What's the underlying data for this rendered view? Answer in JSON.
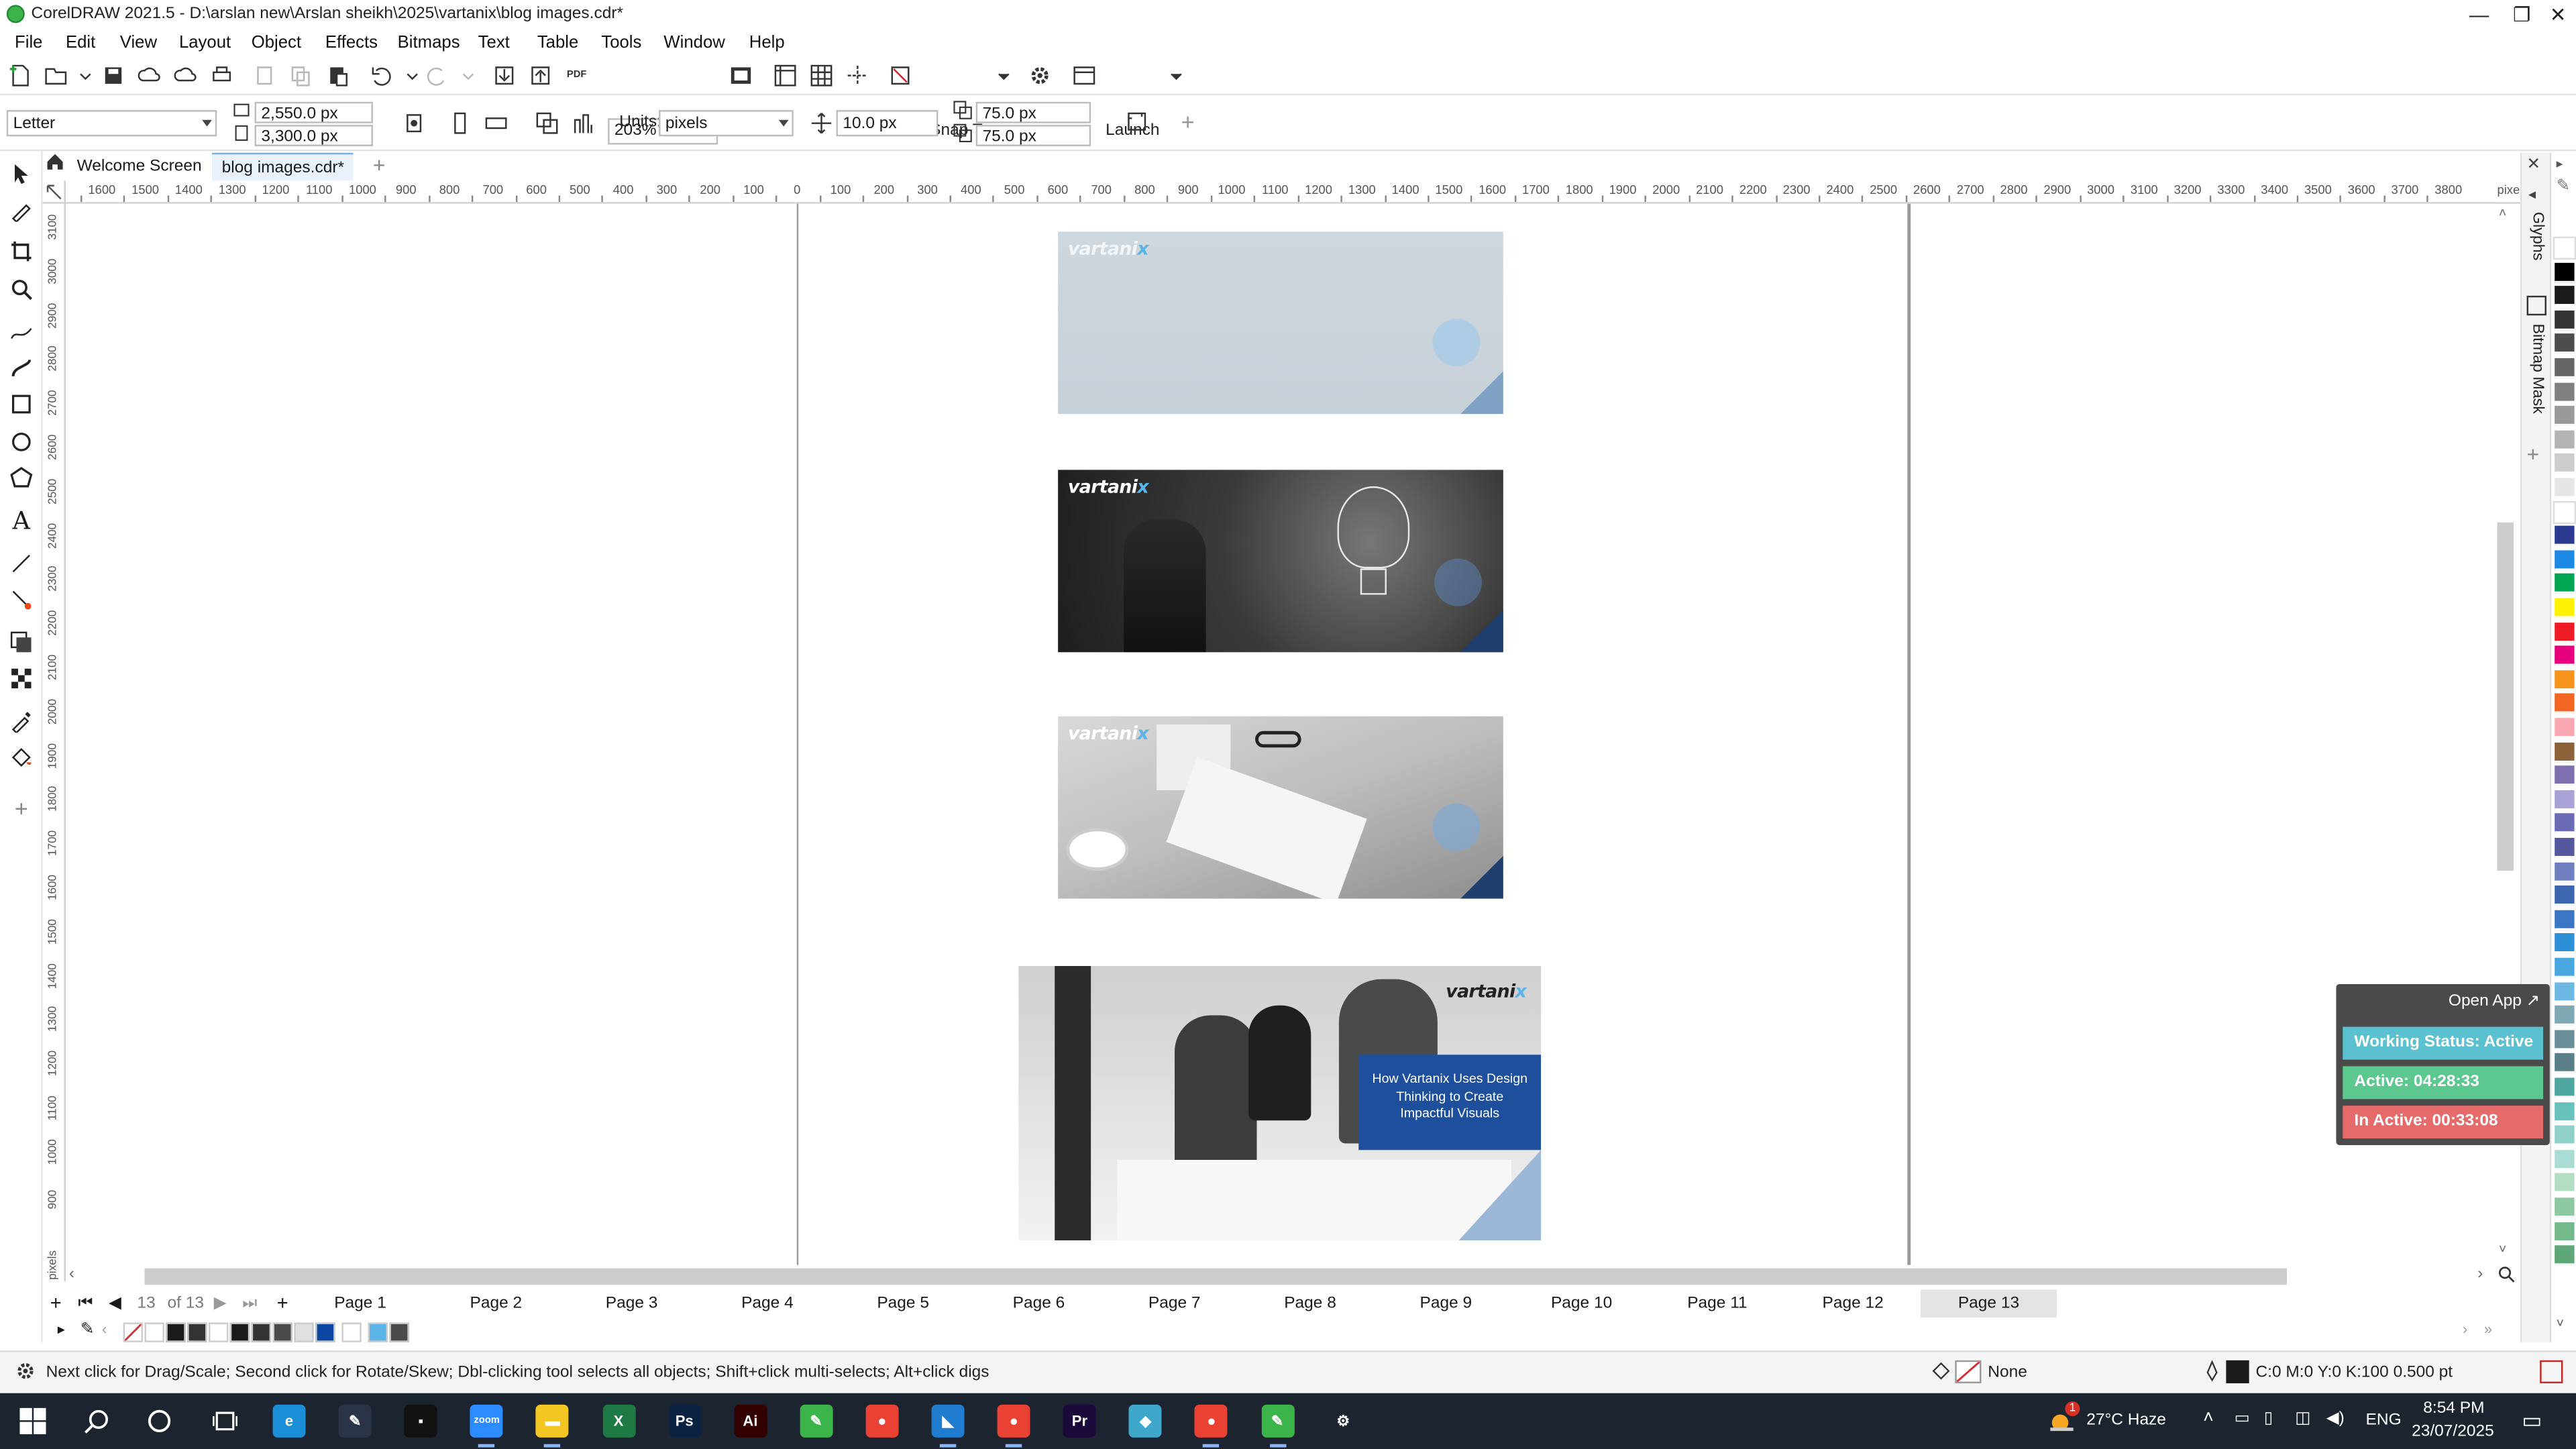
{
  "window": {
    "title": "CorelDRAW 2021.5 - D:\\arslan new\\Arslan sheikh\\2025\\vartanix\\blog images.cdr*",
    "controls": {
      "minimize": "—",
      "restore": "❐",
      "close": "✕"
    }
  },
  "menu": [
    "File",
    "Edit",
    "View",
    "Layout",
    "Object",
    "Effects",
    "Bitmaps",
    "Text",
    "Table",
    "Tools",
    "Window",
    "Help"
  ],
  "toolbar": {
    "zoom": "203%",
    "snap_to": "Snap To",
    "launch": "Launch",
    "pdf_label": "PDF"
  },
  "property_bar": {
    "page_size": "Letter",
    "width": "2,550.0 px",
    "height": "3,300.0 px",
    "units_label": "Units:",
    "units_value": "pixels",
    "nudge": "10.0 px",
    "dup_x": "75.0 px",
    "dup_y": "75.0 px"
  },
  "doc_tabs": {
    "welcome": "Welcome Screen",
    "active": "blog images.cdr*",
    "add": "+"
  },
  "ruler": {
    "h_ticks": [
      "1600",
      "1500",
      "1400",
      "1300",
      "1200",
      "1100",
      "1000",
      "900",
      "800",
      "700",
      "600",
      "500",
      "400",
      "300",
      "200",
      "100",
      "0",
      "100",
      "200",
      "300",
      "400",
      "500",
      "600",
      "700",
      "800",
      "900",
      "1000",
      "1100",
      "1200",
      "1300",
      "1400",
      "1500",
      "1600",
      "1700",
      "1800",
      "1900",
      "2000",
      "2100",
      "2200",
      "2300",
      "2400",
      "2500",
      "2600",
      "2700",
      "2800",
      "2900",
      "3000",
      "3100",
      "3200",
      "3300",
      "3400",
      "3500",
      "3600",
      "3700",
      "3800"
    ],
    "h_unit": "pixels",
    "v_ticks": [
      "3100",
      "3000",
      "2900",
      "2800",
      "2700",
      "2600",
      "2500",
      "2400",
      "2300",
      "2200",
      "2100",
      "2000",
      "1900",
      "1800",
      "1700",
      "1600",
      "1500",
      "1400",
      "1300",
      "1200",
      "1100",
      "1000",
      "900"
    ],
    "v_unit": "pixels"
  },
  "canvas": {
    "images": [
      {
        "brand": "vartani",
        "brand_x": "x",
        "style": "light"
      },
      {
        "brand": "vartani",
        "brand_x": "x",
        "style": "bulb"
      },
      {
        "brand": "vartani",
        "brand_x": "x",
        "style": "desk"
      },
      {
        "brand": "vartani",
        "brand_x": "x",
        "style": "team",
        "caption": "How Vartanix Uses Design Thinking to Create Impactful Visuals"
      }
    ]
  },
  "docker": {
    "glyphs": "Glyphs",
    "bitmap_mask": "Bitmap Mask"
  },
  "palette_colors": [
    "#ffffff",
    "#000000",
    "#1a1a1a",
    "#333333",
    "#4d4d4d",
    "#666666",
    "#808080",
    "#999999",
    "#b3b3b3",
    "#cccccc",
    "#e6e6e6",
    "#ffffff",
    "#2b3a8f",
    "#1e88e5",
    "#00a651",
    "#fff200",
    "#ed1c24",
    "#e6007e",
    "#f7941d",
    "#f26522",
    "#f9a7b0",
    "#8c6239",
    "#7f6fb1",
    "#a8a3d6",
    "#6d6ab5",
    "#55589f",
    "#6f7fbf",
    "#3c67b0",
    "#3a76c4",
    "#2d8fd5",
    "#49a7e0",
    "#6cb8e3",
    "#7fa8b5",
    "#6b8f99",
    "#5a7f88",
    "#4fa7a2",
    "#66c2bb",
    "#8fd0c9",
    "#a9dcd5",
    "#b3dec4",
    "#8cc8a0",
    "#74b98a",
    "#5ea878"
  ],
  "page_tabs": {
    "counter": "13",
    "of_label": "of 13",
    "pages": [
      "Page 1",
      "Page 2",
      "Page 3",
      "Page 4",
      "Page 5",
      "Page 6",
      "Page 7",
      "Page 8",
      "Page 9",
      "Page 10",
      "Page 11",
      "Page 12",
      "Page 13"
    ],
    "active": "Page 13"
  },
  "doc_palette": [
    "#ffffff",
    "#1a1a1a",
    "#333333",
    "#ffffff",
    "#1a1a1a",
    "#333333",
    "#4a4a4a",
    "#e0e0e0",
    "#0d47a1",
    "#ffffff",
    "#5ab4e8",
    "#4a4a4a"
  ],
  "status": {
    "hint": "Next click for Drag/Scale; Second click for Rotate/Skew; Dbl-clicking tool selects all objects; Shift+click multi-selects; Alt+click digs",
    "fill": "None",
    "outline": "C:0 M:0 Y:0 K:100  0.500 pt"
  },
  "widget": {
    "open_app": "Open App ↗",
    "status": "Working Status: Active",
    "active": "Active: 04:28:33",
    "inactive": "In Active: 00:33:08",
    "colors": {
      "status": "#5bc0cf",
      "active": "#5cc78e",
      "inactive": "#e56b6b"
    }
  },
  "taskbar": {
    "weather": "27°C  Haze",
    "lang": "ENG",
    "time": "8:54 PM",
    "date": "23/07/2025",
    "weather_badge": "1",
    "apps": [
      {
        "name": "edge",
        "label": "e",
        "color": "#1a8fd8"
      },
      {
        "name": "pen",
        "label": "✎",
        "color": "#2a3446"
      },
      {
        "name": "terminal",
        "label": "▪",
        "color": "#111111"
      },
      {
        "name": "zoom",
        "label": "zoom",
        "color": "#2d8cff"
      },
      {
        "name": "explorer",
        "label": "▬",
        "color": "#f3c623"
      },
      {
        "name": "excel",
        "label": "X",
        "color": "#1d7a45"
      },
      {
        "name": "photoshop",
        "label": "Ps",
        "color": "#0b2340"
      },
      {
        "name": "illustrator",
        "label": "Ai",
        "color": "#330000"
      },
      {
        "name": "coreldraw",
        "label": "✎",
        "color": "#3bb54a"
      },
      {
        "name": "chrome",
        "label": "●",
        "color": "#e94235"
      },
      {
        "name": "vscode",
        "label": "◣",
        "color": "#1f7ccf"
      },
      {
        "name": "chrome2",
        "label": "●",
        "color": "#e94235"
      },
      {
        "name": "premiere",
        "label": "Pr",
        "color": "#1a0a3a"
      },
      {
        "name": "app-diamond",
        "label": "◆",
        "color": "#3fa7c9"
      },
      {
        "name": "chrome3",
        "label": "●",
        "color": "#e94235"
      },
      {
        "name": "coreldraw-active",
        "label": "✎",
        "color": "#3bb54a"
      },
      {
        "name": "settings",
        "label": "⚙",
        "color": "#1c2430"
      }
    ]
  }
}
